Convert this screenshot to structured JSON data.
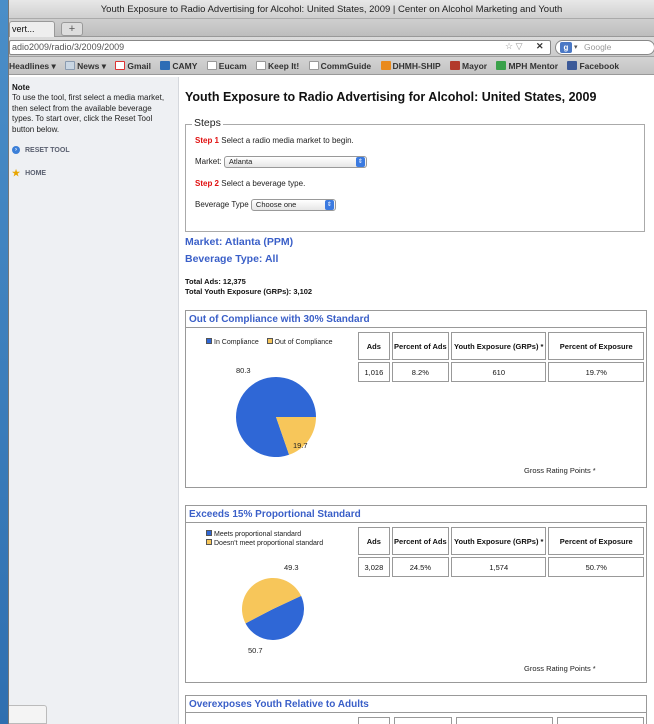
{
  "browser": {
    "window_title": "Youth Exposure to Radio Advertising for Alcohol: United States, 2009 | Center on Alcohol Marketing and Youth",
    "tab_label": "vert...",
    "new_tab": "+",
    "url": "adio2009/radio/3/2009/2009",
    "url_controls": "☆ ▽",
    "stop": "✕",
    "search_engine": "Google",
    "bookmarks": [
      "Headlines ▾",
      "News ▾",
      "Gmail",
      "CAMY",
      "Eucam",
      "Keep It!",
      "CommGuide",
      "DHMH-SHIP",
      "Mayor",
      "MPH Mentor",
      "Facebook"
    ]
  },
  "sidebar": {
    "note_title": "Note",
    "note_text": "To use the tool, first select a media market, then select from the available beverage types. To start over, click the Reset Tool button below.",
    "reset_label": "RESET TOOL",
    "home_label": "HOME"
  },
  "main": {
    "title": "Youth Exposure to Radio Advertising for Alcohol: United States, 2009",
    "steps_legend": "Steps",
    "step1_tag": "Step 1",
    "step1_text": "Select a radio media market to begin.",
    "market_label": "Market:",
    "market_value": "Atlanta",
    "step2_tag": "Step 2",
    "step2_text": "Select a beverage type.",
    "beverage_label": "Beverage Type",
    "beverage_value": "Choose one",
    "market_heading": "Market: Atlanta (PPM)",
    "beverage_heading": "Beverage Type: All",
    "total_ads": "Total Ads: 12,375",
    "total_exposure": "Total Youth Exposure (GRPs): 3,102"
  },
  "panels": [
    {
      "title": "Out of Compliance with 30% Standard",
      "legend": [
        "In Compliance",
        "Out of Compliance"
      ],
      "headers": [
        "Ads",
        "Percent of Ads",
        "Youth Exposure (GRPs) *",
        "Percent of Exposure"
      ],
      "values": [
        "1,016",
        "8.2%",
        "610",
        "19.7%"
      ],
      "pie_labels": [
        "80.3",
        "19.7"
      ],
      "footnote": "Gross Rating Points *"
    },
    {
      "title": "Exceeds 15% Proportional Standard",
      "legend": [
        "Meets proportional standard",
        "Doesn't meet proportional standard"
      ],
      "headers": [
        "Ads",
        "Percent of Ads",
        "Youth Exposure (GRPs) *",
        "Percent of Exposure"
      ],
      "values": [
        "3,028",
        "24.5%",
        "1,574",
        "50.7%"
      ],
      "pie_labels": [
        "49.3",
        "50.7"
      ],
      "footnote": "Gross Rating Points *"
    },
    {
      "title": "Overexposes Youth Relative to Adults"
    }
  ],
  "pies": [
    {
      "values": [
        80.3,
        19.7
      ],
      "colors": [
        "#2f67d6",
        "#f7c65a"
      ]
    },
    {
      "values": [
        49.3,
        50.7
      ],
      "colors": [
        "#2f67d6",
        "#f7c65a"
      ]
    }
  ]
}
